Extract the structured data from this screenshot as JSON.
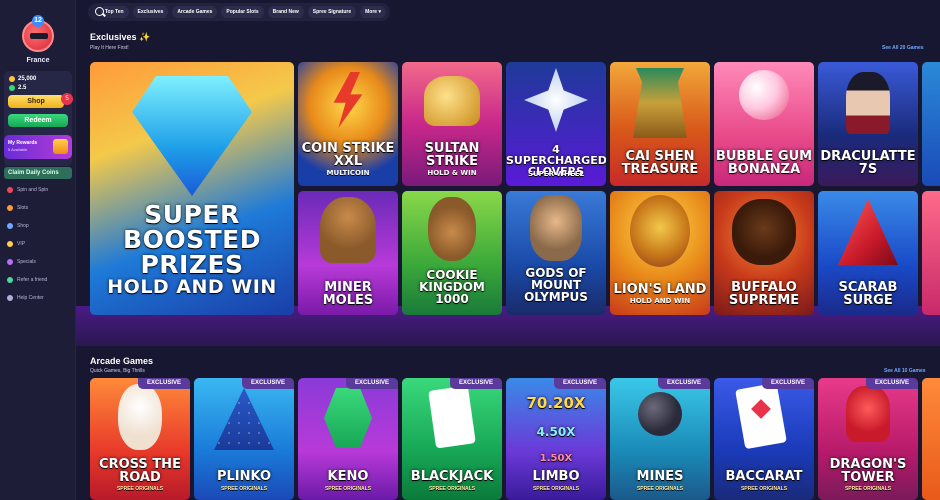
{
  "sidebar": {
    "level": "12",
    "username": "France",
    "balance_gc": "25,000",
    "balance_sc": "2.5",
    "shop_label": "Shop",
    "shop_badge": "5",
    "redeem_label": "Redeem",
    "rewards_title": "My Rewards",
    "rewards_sub": "5 Available",
    "claim_label": "Claim Daily Coins",
    "nav": [
      {
        "label": "Spin and Spin",
        "icon": "wheel-icon",
        "color": "#e84a5a"
      },
      {
        "label": "Slots",
        "icon": "slot-icon",
        "color": "#ff9a3a"
      },
      {
        "label": "Shop",
        "icon": "cart-icon",
        "color": "#6fa8ff"
      },
      {
        "label": "VIP",
        "icon": "crown-icon",
        "color": "#ffd04a"
      },
      {
        "label": "Specials",
        "icon": "star-icon",
        "color": "#b86bff"
      },
      {
        "label": "Refer a friend",
        "icon": "gift-icon",
        "color": "#4ad8a0"
      },
      {
        "label": "Help Center",
        "icon": "help-icon",
        "color": "#aab0d8"
      }
    ]
  },
  "topnav": {
    "tabs": [
      "Top Ten",
      "Exclusives",
      "Arcade Games",
      "Popular Slots",
      "Brand New",
      "Spree Signature",
      "More ▾"
    ]
  },
  "exclusives": {
    "title": "Exclusives ✨",
    "subtitle": "Play It Here First!",
    "see_all": "See All 20 Games",
    "hero": {
      "line1": "SUPER",
      "line2": "BOOSTED",
      "line3": "PRIZES",
      "line4": "HOLD AND WIN"
    },
    "row1": [
      {
        "name": "COIN STRIKE XXL",
        "sub": "MULTICOIN"
      },
      {
        "name": "SULTAN STRIKE",
        "sub": "HOLD & WIN"
      },
      {
        "name": "4 SUPERCHARGED CLOVERS",
        "sub": "SUPER WHEEL"
      },
      {
        "name": "CAI SHEN TREASURE",
        "sub": ""
      },
      {
        "name": "BUBBLE GUM BONANZA",
        "sub": ""
      },
      {
        "name": "DRACULATTE 7S",
        "sub": ""
      }
    ],
    "row2": [
      {
        "name": "MINER MOLES",
        "sub": ""
      },
      {
        "name": "COOKIE KINGDOM 1000",
        "sub": ""
      },
      {
        "name": "GODS OF MOUNT OLYMPUS",
        "sub": ""
      },
      {
        "name": "LION'S LAND",
        "sub": "HOLD AND WIN"
      },
      {
        "name": "BUFFALO SUPREME",
        "sub": ""
      },
      {
        "name": "SCARAB SURGE",
        "sub": ""
      }
    ]
  },
  "arcade": {
    "title": "Arcade Games",
    "subtitle": "Quick Games, Big Thrills",
    "see_all": "See All 10 Games",
    "badge": "EXCLUSIVE",
    "tag": "SPREE ORIGINALS",
    "games": [
      {
        "name": "CROSS THE ROAD"
      },
      {
        "name": "PLINKO"
      },
      {
        "name": "KENO"
      },
      {
        "name": "BLACKJACK"
      },
      {
        "name": "LIMBO",
        "multipliers": [
          "70.20X",
          "4.50X",
          "1.50X"
        ]
      },
      {
        "name": "MINES"
      },
      {
        "name": "BACCARAT"
      },
      {
        "name": "DRAGON'S TOWER"
      }
    ]
  }
}
